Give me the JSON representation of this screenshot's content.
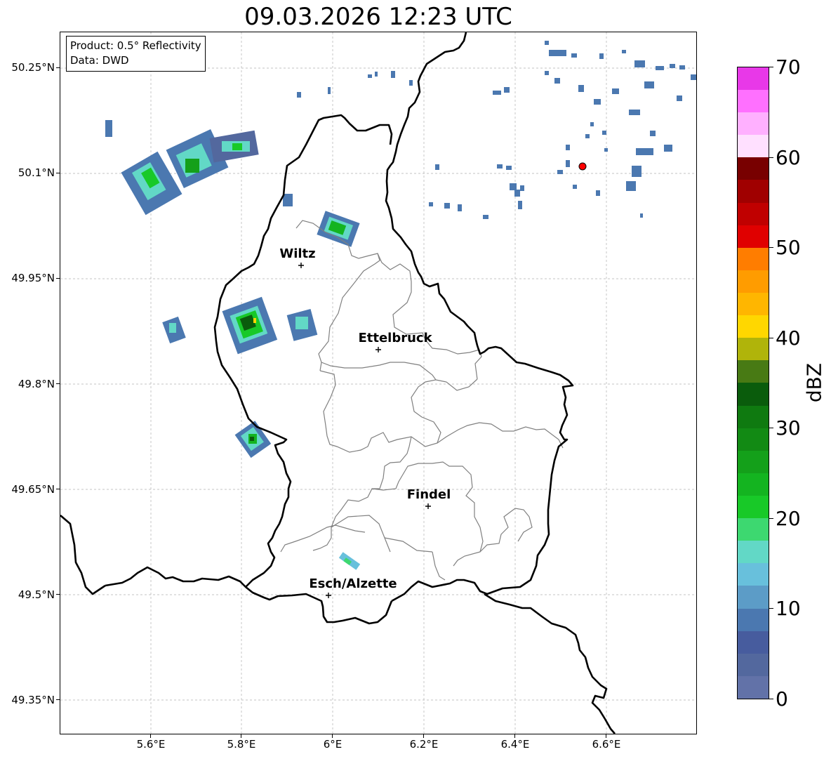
{
  "title": "09.03.2026 12:23 UTC",
  "info_box": {
    "product": "Product: 0.5° Reflectivity",
    "data": "Data: DWD"
  },
  "y_axis_labels": [
    "50.25°N",
    "50.1°N",
    "49.95°N",
    "49.8°N",
    "49.65°N",
    "49.5°N",
    "49.35°N"
  ],
  "x_axis_labels": [
    "5.6°E",
    "5.8°E",
    "6°E",
    "6.2°E",
    "6.4°E",
    "6.6°E"
  ],
  "cities": [
    {
      "name": "Wiltz"
    },
    {
      "name": "Ettelbruck"
    },
    {
      "name": "Findel"
    },
    {
      "name": "Esch/Alzette"
    }
  ],
  "colorbar": {
    "unit": "dBZ",
    "tick_labels": [
      "0",
      "10",
      "20",
      "30",
      "40",
      "50",
      "60",
      "70"
    ],
    "colors": [
      "#6272a8",
      "#53689e",
      "#475c9e",
      "#4b78b0",
      "#5c9cc7",
      "#68c0dc",
      "#62d8c6",
      "#3dd870",
      "#18c928",
      "#14b420",
      "#14a01a",
      "#128a14",
      "#0f7a10",
      "#0a5c0c",
      "#487a14",
      "#b0b40a",
      "#ffd700",
      "#ffb600",
      "#ff9c00",
      "#ff7d00",
      "#e00000",
      "#c00000",
      "#a00000",
      "#780000",
      "#ffe0ff",
      "#ffb0ff",
      "#ff70ff",
      "#e838e8"
    ]
  },
  "colors": {
    "border": "#000000",
    "canton_lines": "#808080",
    "grid": "#b0b0b0",
    "radar_site_marker": "#ff0000"
  }
}
